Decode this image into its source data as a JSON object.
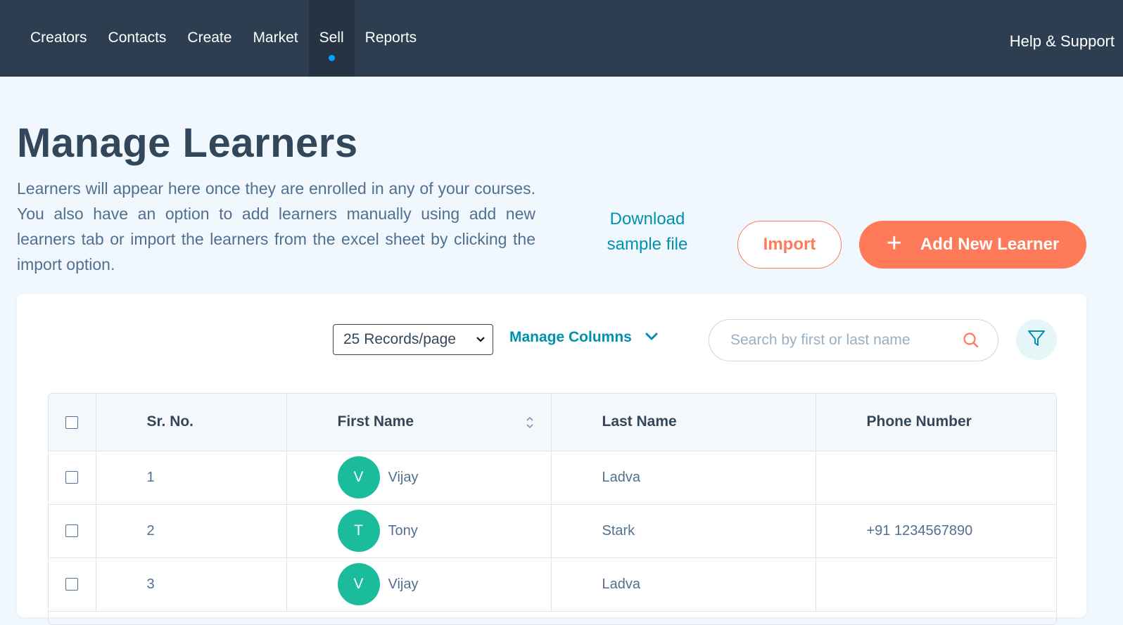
{
  "nav": {
    "items": [
      {
        "label": "Creators",
        "active": false
      },
      {
        "label": "Contacts",
        "active": false
      },
      {
        "label": "Create",
        "active": false
      },
      {
        "label": "Market",
        "active": false
      },
      {
        "label": "Sell",
        "active": true
      },
      {
        "label": "Reports",
        "active": false
      }
    ],
    "help_label": "Help & Support"
  },
  "header": {
    "title": "Manage Learners",
    "description": "Learners will appear here once they are enrolled in any of your courses. You also have an option to add learners manually using add new learners tab or import the learners from the excel sheet by clicking the import option.",
    "download_line1": "Download",
    "download_line2": "sample file",
    "import_label": "Import",
    "add_label": "Add New Learner",
    "add_icon": "plus-icon"
  },
  "toolbar": {
    "records_per_page": "25 Records/page",
    "manage_columns_label": "Manage Columns",
    "search_placeholder": "Search by first or last name",
    "search_icon": "search-icon",
    "filter_icon": "filter-icon"
  },
  "table": {
    "columns": [
      "Sr. No.",
      "First Name",
      "Last Name",
      "Phone Number"
    ],
    "rows": [
      {
        "sr": "1",
        "initial": "V",
        "first": "Vijay",
        "last": "Ladva",
        "phone": ""
      },
      {
        "sr": "2",
        "initial": "T",
        "first": "Tony",
        "last": "Stark",
        "phone": "+91 1234567890"
      },
      {
        "sr": "3",
        "initial": "V",
        "first": "Vijay",
        "last": "Ladva",
        "phone": ""
      }
    ]
  },
  "colors": {
    "nav_bg": "#2d3e50",
    "accent_orange": "#ff7a59",
    "link_blue": "#0091ae",
    "avatar_green": "#1abc9c",
    "page_bg": "#f0f8fd"
  }
}
